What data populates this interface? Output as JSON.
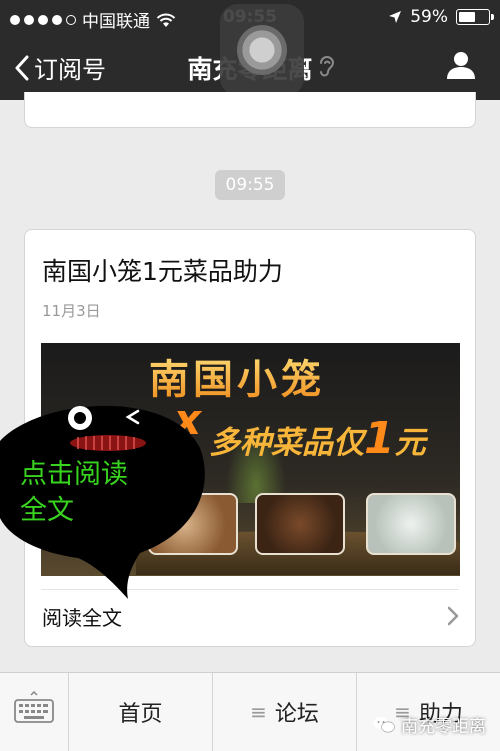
{
  "status_bar": {
    "carrier": "中国联通",
    "time": "09:55",
    "battery_percent_text": "59%",
    "battery_level": 0.59,
    "signal_dots_filled": 4,
    "signal_dots_total": 5
  },
  "nav": {
    "back_label": "订阅号",
    "title": "南充零距离"
  },
  "chat": {
    "timestamp": "09:55"
  },
  "article": {
    "title": "南国小笼1元菜品助力",
    "date": "11月3日",
    "image_text": {
      "headline": "南国小笼",
      "subline_prefix": "多种菜品仅",
      "subline_number": "1",
      "subline_suffix": "元"
    },
    "overlay_text_line1": "点击阅读",
    "overlay_text_line2": "全文",
    "read_more": "阅读全文"
  },
  "toolbar": {
    "items": [
      {
        "label": "首页",
        "has_menu_glyph": false
      },
      {
        "label": "论坛",
        "has_menu_glyph": true
      },
      {
        "label": "助力",
        "has_menu_glyph": true
      }
    ],
    "menu_glyph": "≡"
  },
  "watermark": "南充零距离",
  "colors": {
    "bar_bg": "#2b2b2b",
    "page_bg": "#ebebeb",
    "overlay_text": "#39d41f",
    "accent_orange": "#f08a1a"
  },
  "icons": {
    "back": "chevron-left-icon",
    "ear": "ear-icon",
    "profile": "person-icon",
    "keyboard": "keyboard-icon",
    "read_more": "chevron-right-icon",
    "wifi": "wifi-icon",
    "location": "location-arrow-icon",
    "battery": "battery-icon"
  }
}
